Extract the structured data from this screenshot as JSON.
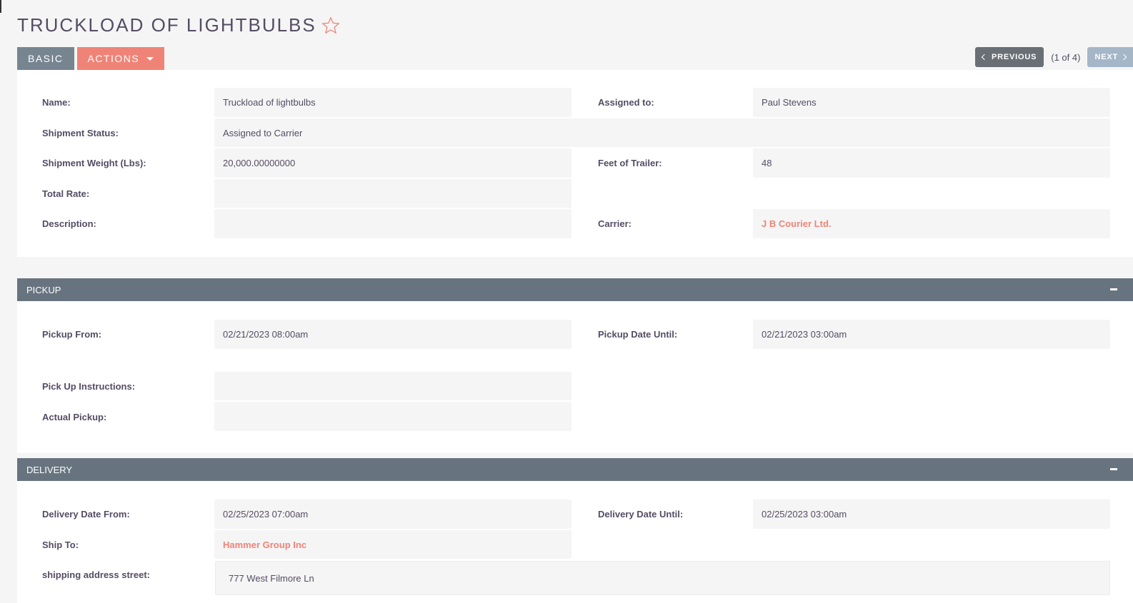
{
  "header": {
    "title": "TRUCKLOAD OF LIGHTBULBS",
    "favorite_icon": "star-outline-icon"
  },
  "tabs": {
    "basic": "BASIC",
    "actions": "ACTIONS"
  },
  "pager": {
    "previous": "PREVIOUS",
    "count": "(1 of 4)",
    "next": "NEXT"
  },
  "colors": {
    "accent": "#f08377",
    "section_header": "#677480",
    "tab_basic": "#778591"
  },
  "basic": {
    "name_label": "Name:",
    "name_value": "Truckload of lightbulbs",
    "assigned_label": "Assigned to:",
    "assigned_value": "Paul Stevens",
    "status_label": "Shipment Status:",
    "status_value": "Assigned to Carrier",
    "weight_label": "Shipment Weight (Lbs):",
    "weight_value": "20,000.00000000",
    "feet_label": "Feet of Trailer:",
    "feet_value": "48",
    "rate_label": "Total Rate:",
    "rate_value": "",
    "description_label": "Description:",
    "description_value": "",
    "carrier_label": "Carrier:",
    "carrier_value": "J B Courier Ltd."
  },
  "pickup": {
    "title": "PICKUP",
    "from_label": "Pickup From:",
    "from_value": "02/21/2023 08:00am",
    "until_label": "Pickup Date Until:",
    "until_value": "02/21/2023 03:00am",
    "instructions_label": "Pick Up Instructions:",
    "instructions_value": "",
    "actual_label": "Actual Pickup:",
    "actual_value": ""
  },
  "delivery": {
    "title": "DELIVERY",
    "from_label": "Delivery Date From:",
    "from_value": "02/25/2023 07:00am",
    "until_label": "Delivery Date Until:",
    "until_value": "02/25/2023 03:00am",
    "ship_to_label": "Ship To:",
    "ship_to_value": "Hammer Group Inc",
    "street_label": "shipping address street:",
    "street_value": "777 West Filmore Ln"
  }
}
